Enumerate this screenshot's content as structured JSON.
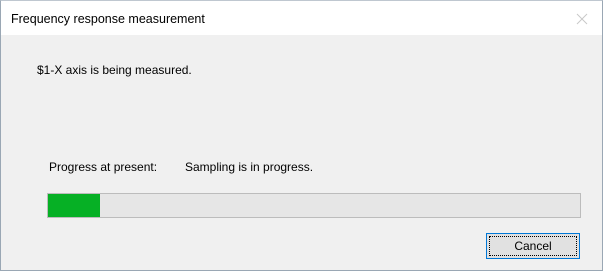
{
  "window": {
    "title": "Frequency response measurement"
  },
  "titlebar": {
    "close_icon": "close-icon"
  },
  "main": {
    "message": "$1-X axis is being measured.",
    "progress_label": "Progress at present:",
    "status_text": "Sampling is in progress.",
    "progress_fraction": 0.098,
    "progress_color": "#06b025"
  },
  "buttons": {
    "cancel_label": "Cancel"
  }
}
